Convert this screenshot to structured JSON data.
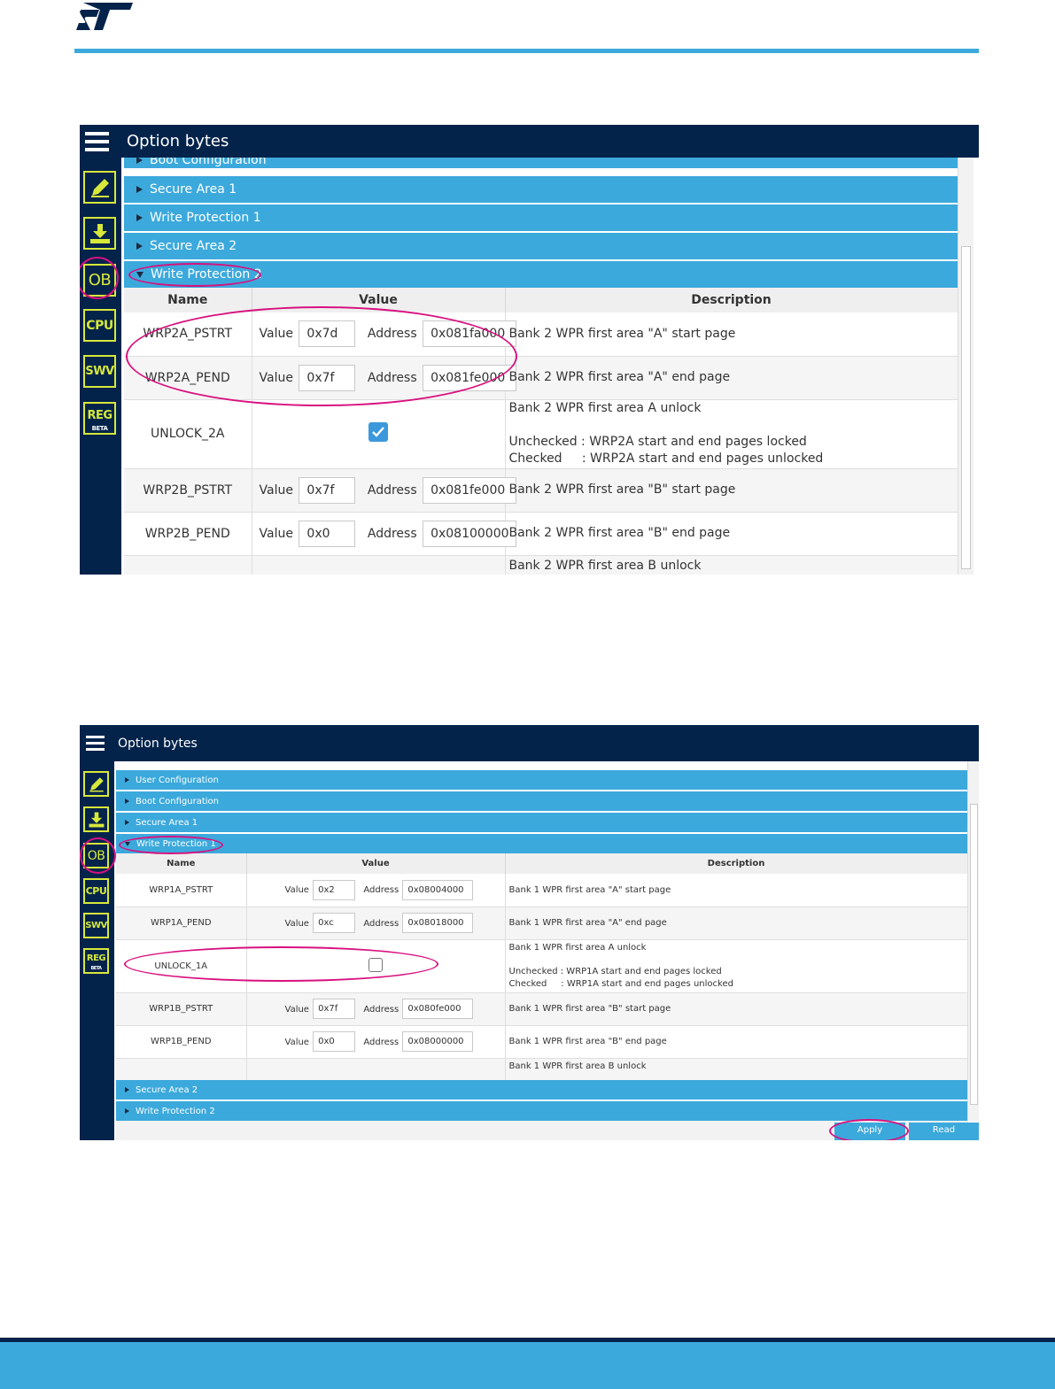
{
  "brand": {
    "logo_text": "ST",
    "accent": "#3ca9dc",
    "dark": "#03234b",
    "highlight": "#d8117f"
  },
  "shot1": {
    "title": "Option bytes",
    "sidebar": [
      {
        "icon": "edit-icon",
        "label": ""
      },
      {
        "icon": "download-icon",
        "label": ""
      },
      {
        "icon": "ob-icon",
        "label": "OB"
      },
      {
        "icon": "cpu-icon",
        "label": "CPU"
      },
      {
        "icon": "swv-icon",
        "label": "SWV"
      },
      {
        "icon": "reg-icon",
        "label": "REG",
        "badge": "BETA"
      }
    ],
    "sections_top": [
      "Boot Configuration",
      "Secure Area 1",
      "Write Protection 1",
      "Secure Area 2"
    ],
    "open_section": "Write Protection 2",
    "columns": [
      "Name",
      "Value",
      "Description"
    ],
    "value_label": "Value",
    "address_label": "Address",
    "rows": [
      {
        "name": "WRP2A_PSTRT",
        "value": "0x7d",
        "address": "0x081fa000",
        "desc": "Bank 2 WPR first area \"A\" start page"
      },
      {
        "name": "WRP2A_PEND",
        "value": "0x7f",
        "address": "0x081fe000",
        "desc": "Bank 2 WPR first area \"A\" end page"
      },
      {
        "name": "UNLOCK_2A",
        "checked": true,
        "desc": "Bank 2 WPR first area A unlock\n\nUnchecked : WRP2A start and end pages locked\nChecked     : WRP2A start and end pages unlocked"
      },
      {
        "name": "WRP2B_PSTRT",
        "value": "0x7f",
        "address": "0x081fe000",
        "desc": "Bank 2 WPR first area \"B\" start page"
      },
      {
        "name": "WRP2B_PEND",
        "value": "0x0",
        "address": "0x08100000",
        "desc": "Bank 2 WPR first area \"B\" end page"
      },
      {
        "name": "",
        "desc": "Bank 2 WPR first area B unlock"
      }
    ]
  },
  "shot2": {
    "title": "Option bytes",
    "sections_top": [
      "User Configuration",
      "Boot Configuration",
      "Secure Area 1"
    ],
    "open_section": "Write Protection 1",
    "columns": [
      "Name",
      "Value",
      "Description"
    ],
    "value_label": "Value",
    "address_label": "Address",
    "rows": [
      {
        "name": "WRP1A_PSTRT",
        "value": "0x2",
        "address": "0x08004000",
        "desc": "Bank 1 WPR first area \"A\" start page"
      },
      {
        "name": "WRP1A_PEND",
        "value": "0xc",
        "address": "0x08018000",
        "desc": "Bank 1 WPR first area \"A\" end page"
      },
      {
        "name": "UNLOCK_1A",
        "checked": false,
        "desc": "Bank 1 WPR first area A unlock\n\nUnchecked : WRP1A start and end pages locked\nChecked     : WRP1A start and end pages unlocked"
      },
      {
        "name": "WRP1B_PSTRT",
        "value": "0x7f",
        "address": "0x080fe000",
        "desc": "Bank 1 WPR first area \"B\" start page"
      },
      {
        "name": "WRP1B_PEND",
        "value": "0x0",
        "address": "0x08000000",
        "desc": "Bank 1 WPR first area \"B\" end page"
      },
      {
        "name": "",
        "desc": "Bank 1 WPR first area B unlock"
      }
    ],
    "sections_bottom": [
      "Secure Area 2",
      "Write Protection 2"
    ],
    "apply_label": "Apply",
    "read_label": "Read"
  }
}
